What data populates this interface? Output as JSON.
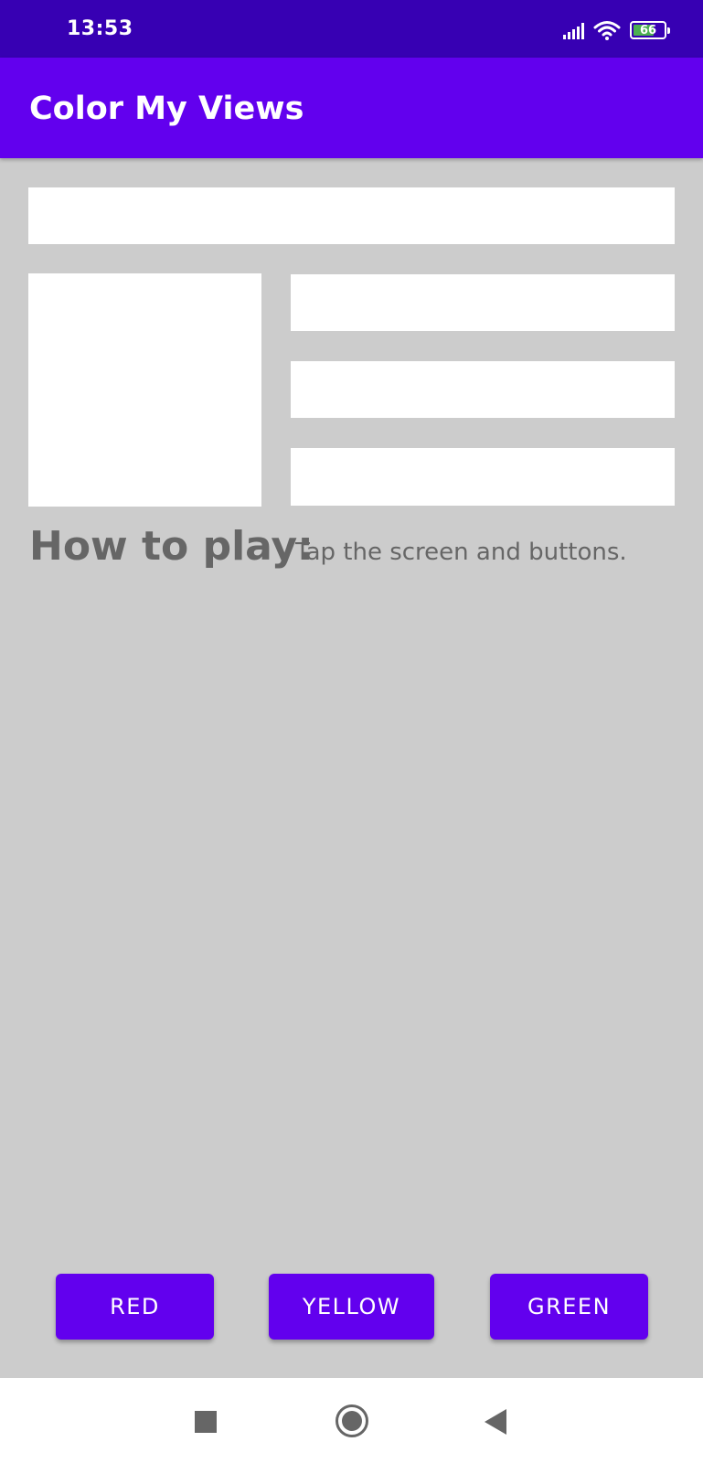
{
  "status_bar": {
    "time": "13:53",
    "battery_level": "66",
    "icons": [
      "signal-icon",
      "wifi-icon",
      "battery-icon"
    ],
    "background": "#3700b3"
  },
  "app_bar": {
    "title": "Color My Views",
    "background": "#6200ee"
  },
  "main": {
    "heading": "How to play:",
    "instructions": "Tap the screen and buttons.",
    "boxes": [
      "box-one",
      "box-two",
      "box-three",
      "box-four",
      "box-five"
    ]
  },
  "buttons": {
    "red_label": "RED",
    "yellow_label": "YELLOW",
    "green_label": "GREEN",
    "color": "#6200ee"
  },
  "nav_bar": {
    "icons": [
      "recents-icon",
      "home-icon",
      "back-icon"
    ]
  },
  "colors": {
    "background": "#cccccc",
    "box": "#ffffff",
    "text": "#666666"
  }
}
